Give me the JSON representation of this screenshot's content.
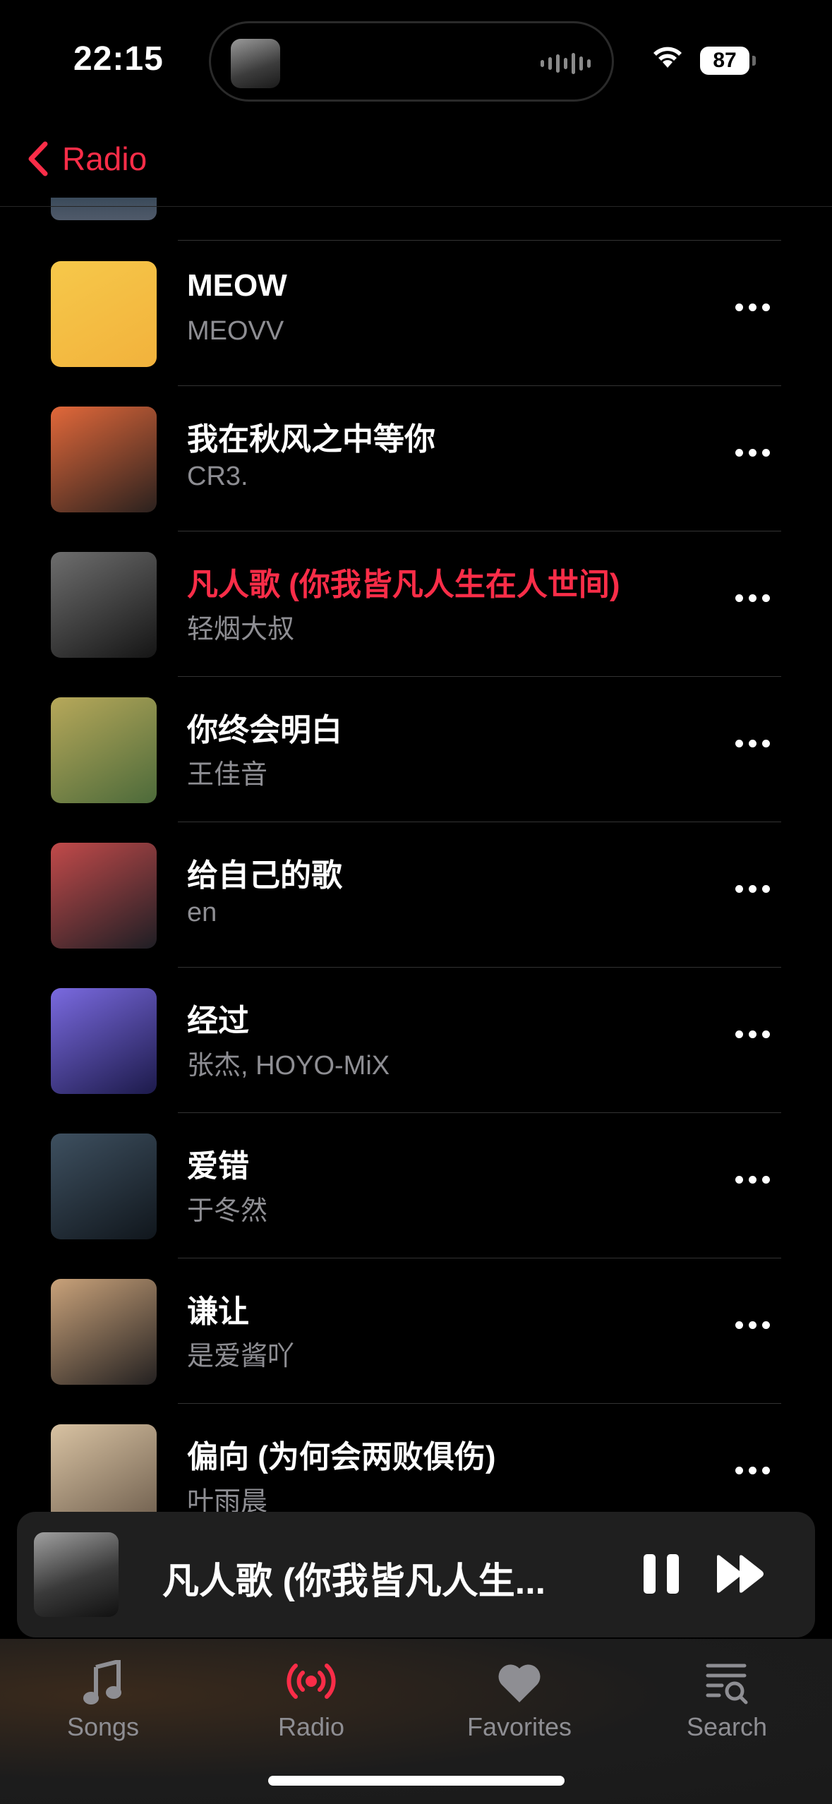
{
  "status": {
    "time": "22:15",
    "battery": "87"
  },
  "nav": {
    "back_label": "Radio"
  },
  "songs": [
    {
      "title": "MEOW",
      "artist": "MEOVV",
      "art_colors": [
        "#f6c84a",
        "#f2b23c"
      ],
      "playing": false
    },
    {
      "title": "我在秋风之中等你",
      "artist": "CR3.",
      "art_colors": [
        "#e2683a",
        "#2a211e"
      ],
      "playing": false
    },
    {
      "title": "凡人歌 (你我皆凡人生在人世间)",
      "artist": "轻烟大叔",
      "art_colors": [
        "#6e6e6e",
        "#151515"
      ],
      "playing": true
    },
    {
      "title": "你终会明白",
      "artist": "王佳音",
      "art_colors": [
        "#b7a85a",
        "#4c6a3a"
      ],
      "playing": false
    },
    {
      "title": "给自己的歌",
      "artist": "en",
      "art_colors": [
        "#c24a4a",
        "#1e1e24"
      ],
      "playing": false
    },
    {
      "title": "经过",
      "artist": "张杰, HOYO-MiX",
      "art_colors": [
        "#7a6ae0",
        "#1c1a4a"
      ],
      "playing": false
    },
    {
      "title": "爱错",
      "artist": "于冬然",
      "art_colors": [
        "#3e5060",
        "#10161c"
      ],
      "playing": false
    },
    {
      "title": "谦让",
      "artist": "是爱酱吖",
      "art_colors": [
        "#c9a27a",
        "#232020"
      ],
      "playing": false
    },
    {
      "title": "偏向 (为何会两败俱伤)",
      "artist": "叶雨晨",
      "art_colors": [
        "#d8c2a2",
        "#6a5a4a"
      ],
      "playing": false
    }
  ],
  "mini_player": {
    "title": "凡人歌 (你我皆凡人生...",
    "pause_icon": "pause-icon",
    "next_icon": "fast-forward-icon"
  },
  "tabs": [
    {
      "label": "Songs",
      "icon": "music-note-icon",
      "active": false
    },
    {
      "label": "Radio",
      "icon": "radio-broadcast-icon",
      "active": true
    },
    {
      "label": "Favorites",
      "icon": "heart-icon",
      "active": false
    },
    {
      "label": "Search",
      "icon": "search-list-icon",
      "active": false
    }
  ],
  "colors": {
    "accent": "#fa2d48",
    "secondary_text": "#8e8e93",
    "background": "#000000"
  }
}
